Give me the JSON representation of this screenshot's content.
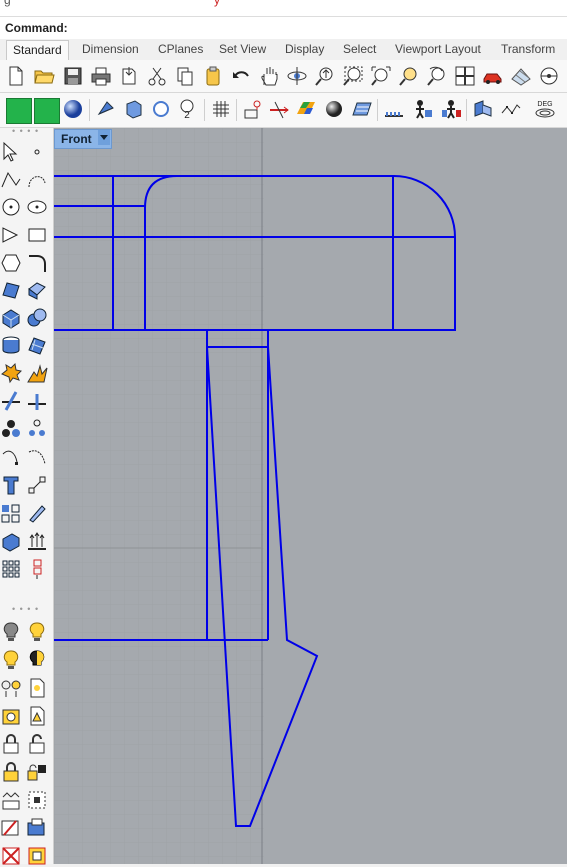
{
  "top_strip": {
    "left_text": "g",
    "red_text": "y"
  },
  "command": {
    "label": "Command:"
  },
  "tabs": [
    {
      "label": "Standard",
      "active": true
    },
    {
      "label": "Dimension"
    },
    {
      "label": "CPlanes"
    },
    {
      "label": "Set View"
    },
    {
      "label": "Display"
    },
    {
      "label": "Select"
    },
    {
      "label": "Viewport Layout"
    },
    {
      "label": "Transform"
    }
  ],
  "toolbar1": {
    "icons": [
      "new-file",
      "open-folder",
      "save",
      "print",
      "import",
      "cut",
      "copy",
      "paste",
      "undo",
      "pan-hand",
      "rotate-view",
      "zoom-dynamic",
      "zoom-window",
      "zoom-extents",
      "zoom-selected",
      "undo-view",
      "four-viewports",
      "car-render",
      "grid-display",
      "ortho-circle"
    ]
  },
  "toolbar2": {
    "icons": [
      "green-layer",
      "green-layer-2",
      "shaded-sphere",
      "gumball",
      "object-snap",
      "circle-snap",
      "count-2",
      "grid-snap",
      "point-snap",
      "curve-arrows",
      "color-gradient",
      "render-sphere",
      "hatch",
      "record-history",
      "planar-figure",
      "project-figure",
      "perspective-tool",
      "curve-graph",
      "degrees-dial"
    ],
    "count_label": "2",
    "deg_label": "DEG"
  },
  "viewport": {
    "name": "Front",
    "bg_color": "#a5a9ae",
    "curve_color": "#0000e8"
  },
  "left_toolbar": {
    "grip_top": "• • • •",
    "grip_bottom": "• • • •"
  }
}
